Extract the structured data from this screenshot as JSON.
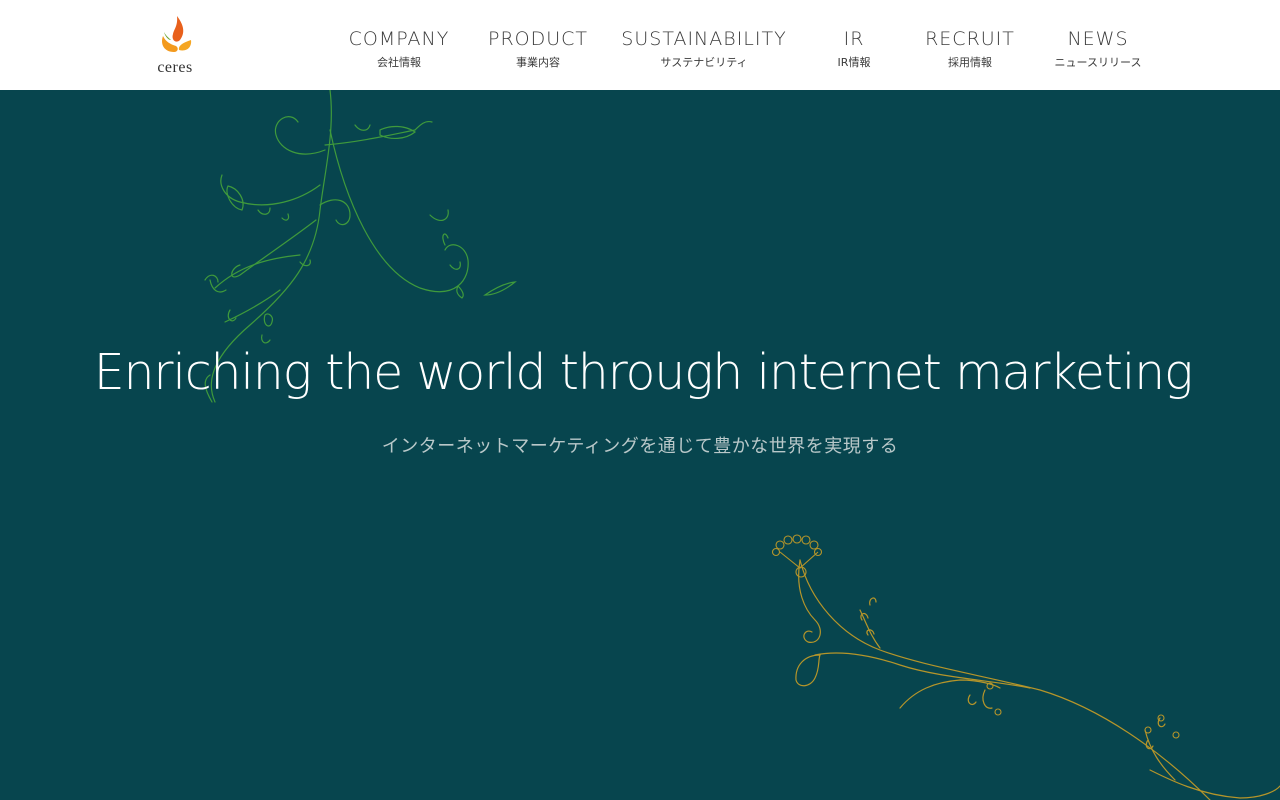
{
  "brand": {
    "logo_text": "ceres",
    "flame_colors": [
      "#e8601c",
      "#f39a1e",
      "#6fa534"
    ]
  },
  "nav": {
    "items": [
      {
        "en": "COMPANY",
        "jp": "会社情報"
      },
      {
        "en": "PRODUCT",
        "jp": "事業内容"
      },
      {
        "en": "SUSTAINABILITY",
        "jp": "サステナビリティ"
      },
      {
        "en": "IR",
        "jp": "IR情報"
      },
      {
        "en": "RECRUIT",
        "jp": "採用情報"
      },
      {
        "en": "NEWS",
        "jp": "ニュースリリース"
      }
    ]
  },
  "hero": {
    "headline": "Enriching the world through internet marketing",
    "subline": "インターネットマーケティングを通じて豊かな世界を実現する",
    "background": "#07454e",
    "ornament_colors": {
      "green": "#3f9a3c",
      "gold": "#b5952a"
    }
  }
}
